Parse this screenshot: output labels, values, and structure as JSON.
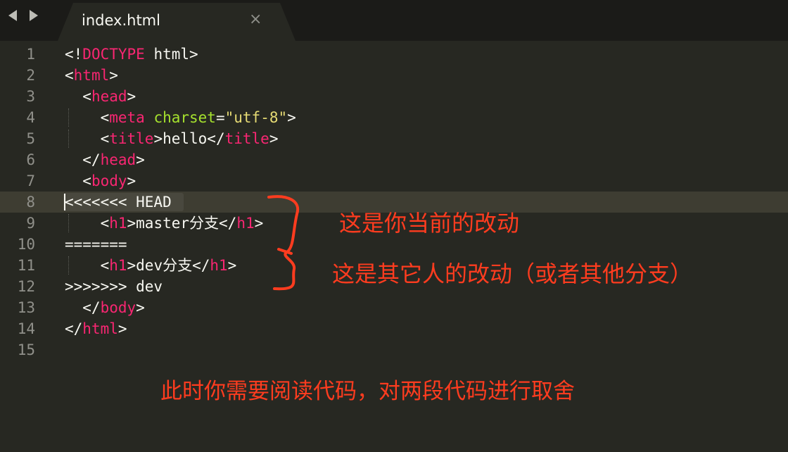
{
  "tab": {
    "title": "index.html",
    "close_glyph": "×"
  },
  "colors": {
    "tag": "#f92672",
    "attr": "#a6e22e",
    "string": "#e6db74",
    "annotation": "#ff3c1f"
  },
  "lines": [
    {
      "n": "1",
      "parts": [
        {
          "t": "<!",
          "c": ""
        },
        {
          "t": "DOCTYPE",
          "c": "tag"
        },
        {
          "t": " html>",
          "c": ""
        }
      ]
    },
    {
      "n": "2",
      "parts": [
        {
          "t": "<",
          "c": ""
        },
        {
          "t": "html",
          "c": "tag"
        },
        {
          "t": ">",
          "c": ""
        }
      ]
    },
    {
      "n": "3",
      "parts": [
        {
          "t": "  <",
          "c": ""
        },
        {
          "t": "head",
          "c": "tag"
        },
        {
          "t": ">",
          "c": ""
        }
      ]
    },
    {
      "n": "4",
      "parts": [
        {
          "t": "    <",
          "c": ""
        },
        {
          "t": "meta",
          "c": "tag"
        },
        {
          "t": " ",
          "c": ""
        },
        {
          "t": "charset",
          "c": "attr"
        },
        {
          "t": "=",
          "c": ""
        },
        {
          "t": "\"utf-8\"",
          "c": "str"
        },
        {
          "t": ">",
          "c": ""
        }
      ]
    },
    {
      "n": "5",
      "parts": [
        {
          "t": "    <",
          "c": ""
        },
        {
          "t": "title",
          "c": "tag"
        },
        {
          "t": ">hello</",
          "c": ""
        },
        {
          "t": "title",
          "c": "tag"
        },
        {
          "t": ">",
          "c": ""
        }
      ]
    },
    {
      "n": "6",
      "parts": [
        {
          "t": "  </",
          "c": ""
        },
        {
          "t": "head",
          "c": "tag"
        },
        {
          "t": ">",
          "c": ""
        }
      ]
    },
    {
      "n": "7",
      "parts": [
        {
          "t": "  <",
          "c": ""
        },
        {
          "t": "body",
          "c": "tag"
        },
        {
          "t": ">",
          "c": ""
        }
      ]
    },
    {
      "n": "8",
      "parts": [
        {
          "t": "<<<<<<< HEAD",
          "c": ""
        }
      ]
    },
    {
      "n": "9",
      "parts": [
        {
          "t": "    <",
          "c": ""
        },
        {
          "t": "h1",
          "c": "tag"
        },
        {
          "t": ">master分支</",
          "c": ""
        },
        {
          "t": "h1",
          "c": "tag"
        },
        {
          "t": ">",
          "c": ""
        }
      ]
    },
    {
      "n": "10",
      "parts": [
        {
          "t": "=======",
          "c": ""
        }
      ]
    },
    {
      "n": "11",
      "parts": [
        {
          "t": "    <",
          "c": ""
        },
        {
          "t": "h1",
          "c": "tag"
        },
        {
          "t": ">dev分支</",
          "c": ""
        },
        {
          "t": "h1",
          "c": "tag"
        },
        {
          "t": ">",
          "c": ""
        }
      ]
    },
    {
      "n": "12",
      "parts": [
        {
          "t": ">>>>>>> dev",
          "c": ""
        }
      ]
    },
    {
      "n": "13",
      "parts": [
        {
          "t": "  </",
          "c": ""
        },
        {
          "t": "body",
          "c": "tag"
        },
        {
          "t": ">",
          "c": ""
        }
      ]
    },
    {
      "n": "14",
      "parts": [
        {
          "t": "</",
          "c": ""
        },
        {
          "t": "html",
          "c": "tag"
        },
        {
          "t": ">",
          "c": ""
        }
      ]
    },
    {
      "n": "15",
      "parts": []
    }
  ],
  "annotations": {
    "current_change": "这是你当前的改动",
    "incoming_change": "这是其它人的改动（或者其他分支）",
    "instruction": "此时你需要阅读代码，对两段代码进行取舍"
  }
}
